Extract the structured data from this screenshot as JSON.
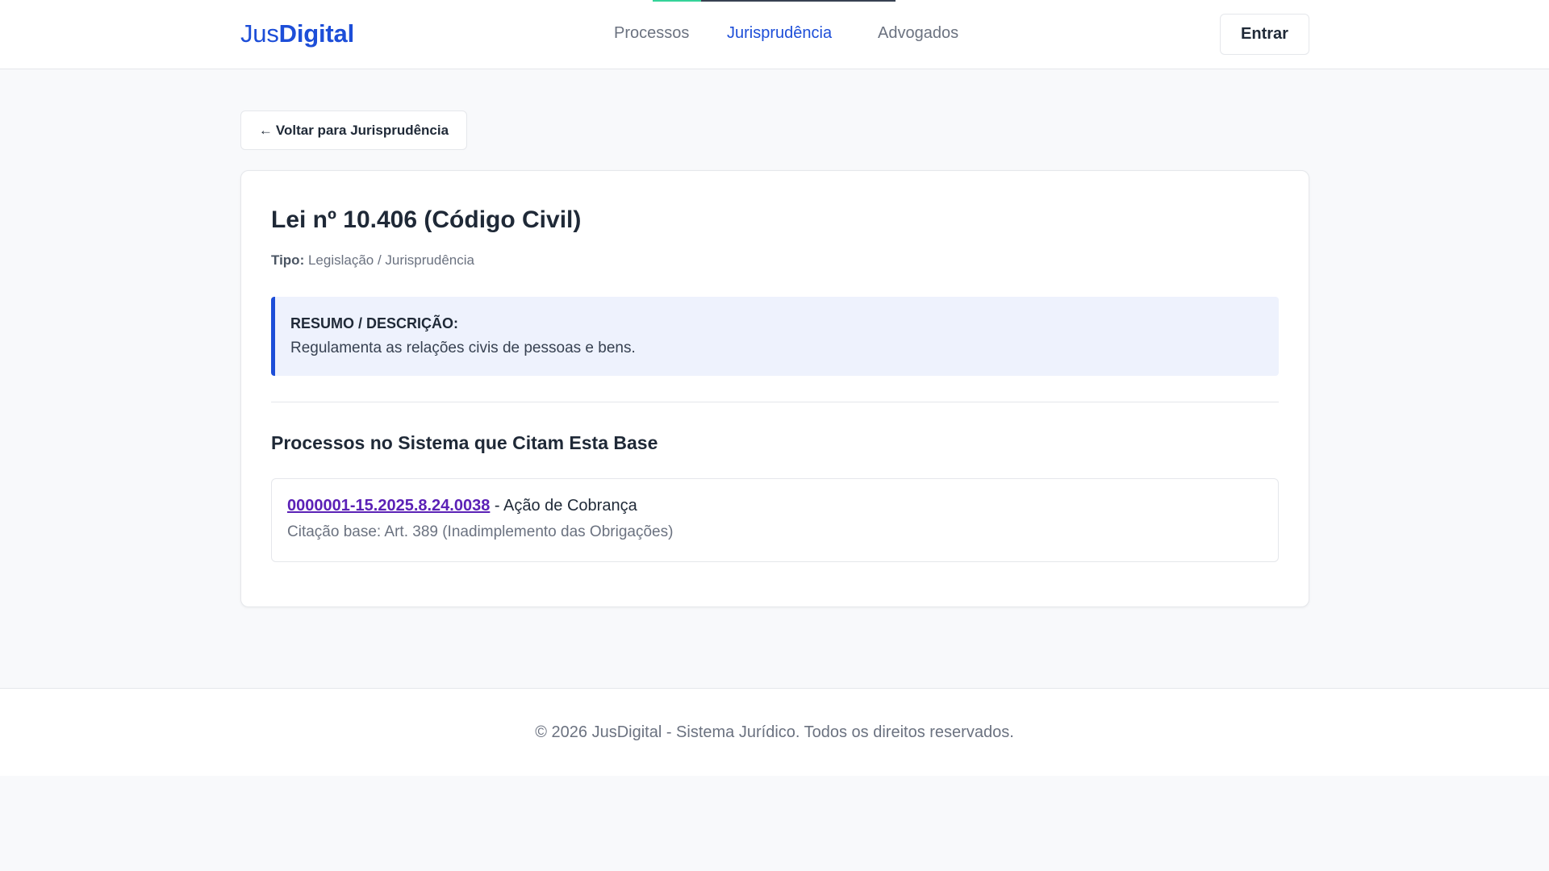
{
  "header": {
    "logo_light": "Jus",
    "logo_bold": "Digital",
    "nav": [
      {
        "label": "Processos"
      },
      {
        "label": "Jurisprudência"
      },
      {
        "label": "Advogados"
      }
    ],
    "active_nav": "Jurisprudência",
    "login_label": "Entrar"
  },
  "back_button": {
    "arrow": "←",
    "label": "Voltar para Jurisprudência"
  },
  "detail": {
    "title": "Lei nº 10.406 (Código Civil)",
    "type_label": "Tipo:",
    "type_value": "Legislação / Jurisprudência",
    "summary_label": "RESUMO / DESCRIÇÃO:",
    "summary_text": "Regulamenta as relações civis de pessoas e bens.",
    "section_title": "Processos no Sistema que Citam Esta Base",
    "processes": [
      {
        "number": "0000001-15.2025.8.24.0038",
        "separator": " - ",
        "name": "Ação de Cobrança",
        "citation": "Citação base: Art. 389 (Inadimplemento das Obrigações)"
      }
    ]
  },
  "footer": {
    "copyright": "© 2026 JusDigital - Sistema Jurídico. Todos os direitos reservados."
  },
  "colors": {
    "brand": "#1d4ed8",
    "visited_link": "#5b21b6",
    "summary_bg": "#eef2fd",
    "page_bg": "#f8f9fb"
  }
}
